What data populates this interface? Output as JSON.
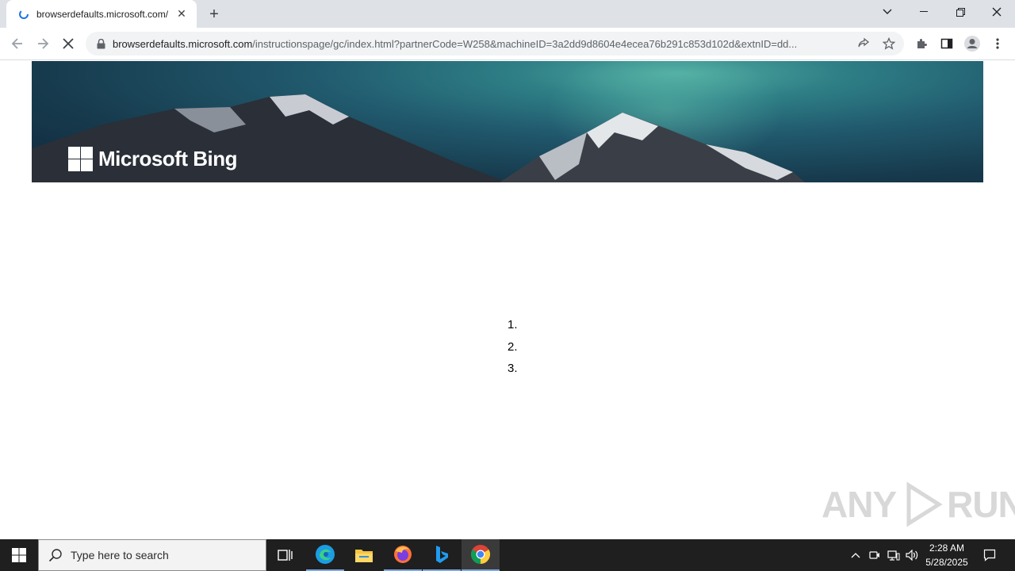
{
  "browser": {
    "tab_title": "browserdefaults.microsoft.com/",
    "url_host": "browserdefaults.microsoft.com",
    "url_path": "/instructionspage/gc/index.html?partnerCode=W258&machineID=3a2dd9d8604e4ecea76b291c853d102d&extnID=dd..."
  },
  "page": {
    "logo_text": "Microsoft Bing",
    "steps": [
      "1.",
      "2.",
      "3."
    ]
  },
  "watermark": {
    "left": "ANY",
    "right": "RUN"
  },
  "taskbar": {
    "search_placeholder": "Type here to search",
    "time": "2:28 AM",
    "date": "5/28/2025"
  },
  "colors": {
    "taskbar_bg": "#1f1f1f",
    "tabstrip_bg": "#dee1e6",
    "accent": "#7aa7e8"
  }
}
